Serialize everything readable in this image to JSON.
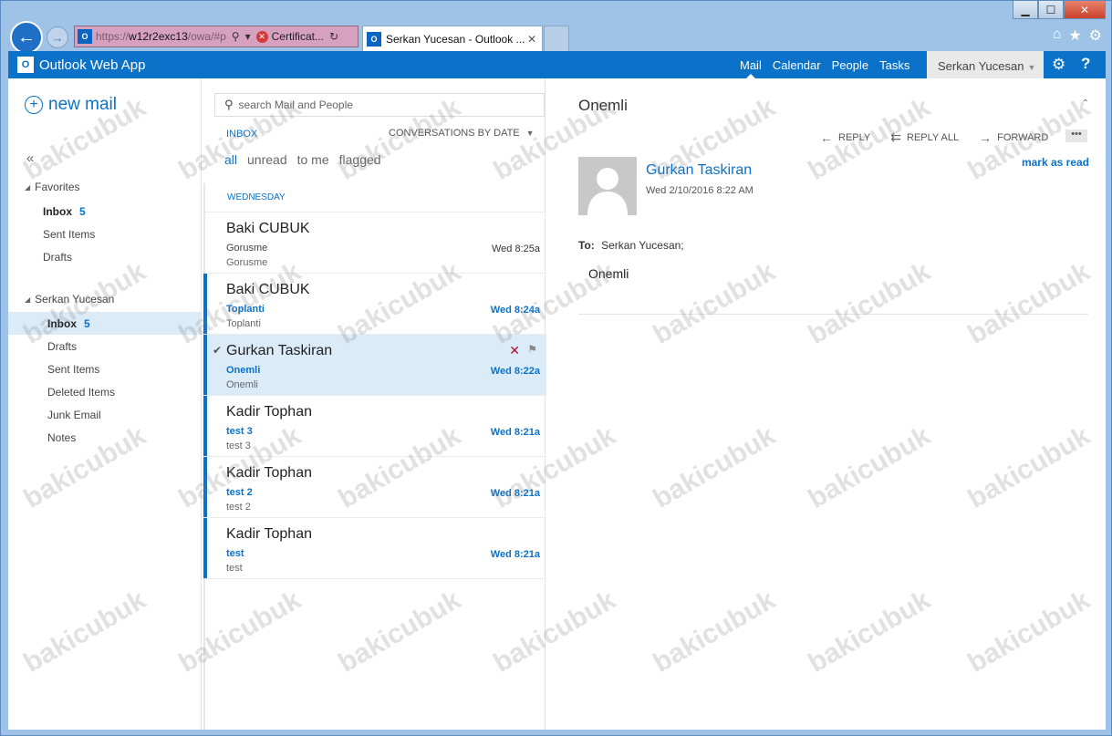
{
  "browser": {
    "address": {
      "url_pre": "https://",
      "url_host": "w12r2exc13",
      "url_post": "/owa/#p",
      "cert_label": "Certificat..."
    },
    "tab": {
      "title": "Serkan Yucesan - Outlook ..."
    },
    "window_controls": {
      "minimize": "▁",
      "maximize": "☐",
      "close": "✕"
    }
  },
  "app": {
    "brand": "Outlook Web App",
    "nav": [
      {
        "label": "Mail",
        "active": true
      },
      {
        "label": "Calendar"
      },
      {
        "label": "People"
      },
      {
        "label": "Tasks"
      }
    ],
    "user": "Serkan Yucesan"
  },
  "leftnav": {
    "new_mail": "new mail",
    "collapse": "«",
    "favorites": {
      "label": "Favorites",
      "items": [
        {
          "label": "Inbox",
          "count": "5"
        },
        {
          "label": "Sent Items"
        },
        {
          "label": "Drafts"
        }
      ]
    },
    "mailbox": {
      "label": "Serkan Yucesan",
      "items": [
        {
          "label": "Inbox",
          "count": "5"
        },
        {
          "label": "Drafts"
        },
        {
          "label": "Sent Items"
        },
        {
          "label": "Deleted Items"
        },
        {
          "label": "Junk Email"
        },
        {
          "label": "Notes"
        }
      ]
    }
  },
  "list": {
    "search_placeholder": "search Mail and People",
    "folder_label": "INBOX",
    "sort_label": "CONVERSATIONS BY DATE",
    "filters": [
      "all",
      "unread",
      "to me",
      "flagged"
    ],
    "day_header": "WEDNESDAY",
    "messages": [
      {
        "from": "Baki CUBUK",
        "subject": "Gorusme",
        "preview": "Gorusme",
        "time": "Wed 8:25a",
        "unread": false
      },
      {
        "from": "Baki CUBUK",
        "subject": "Toplanti",
        "preview": "Toplanti",
        "time": "Wed 8:24a",
        "unread": true
      },
      {
        "from": "Gurkan Taskiran",
        "subject": "Onemli",
        "preview": "Onemli",
        "time": "Wed 8:22a",
        "unread": true,
        "selected": true
      },
      {
        "from": "Kadir Tophan",
        "subject": "test 3",
        "preview": "test 3",
        "time": "Wed 8:21a",
        "unread": true
      },
      {
        "from": "Kadir Tophan",
        "subject": "test 2",
        "preview": "test 2",
        "time": "Wed 8:21a",
        "unread": true
      },
      {
        "from": "Kadir Tophan",
        "subject": "test",
        "preview": "test",
        "time": "Wed 8:21a",
        "unread": true
      }
    ]
  },
  "reading": {
    "subject": "Onemli",
    "actions": {
      "reply": "REPLY",
      "reply_all": "REPLY ALL",
      "forward": "FORWARD",
      "more": "•••"
    },
    "sender": "Gurkan Taskiran",
    "date": "Wed 2/10/2016 8:22 AM",
    "mark_as_read": "mark as read",
    "to_label": "To:",
    "to": "Serkan Yucesan;",
    "body": "Onemli"
  },
  "watermark": "bakicubuk",
  "colors": {
    "accent": "#0a72c9",
    "selected": "#dcebf8",
    "delete": "#b0102a"
  }
}
